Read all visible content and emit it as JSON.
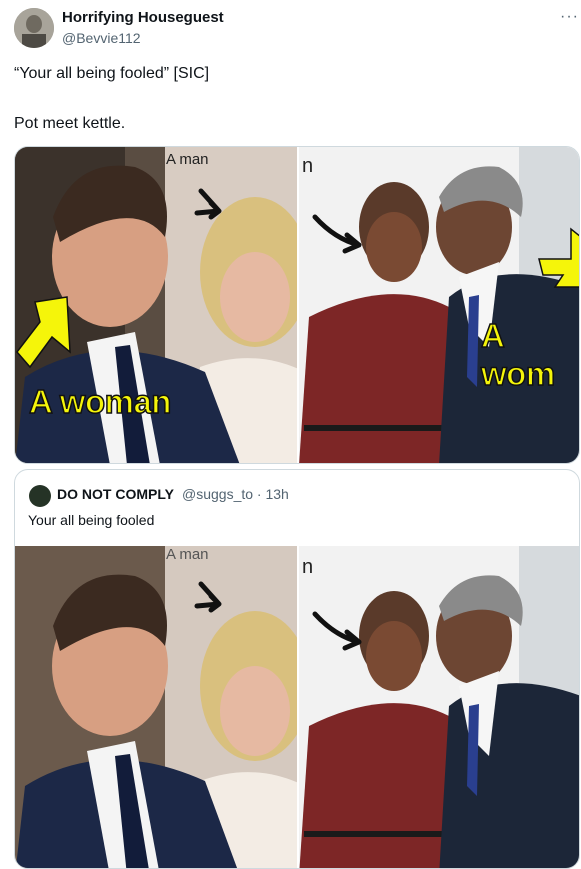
{
  "author": {
    "display_name": "Horrifying Houseguest",
    "handle": "@Bevvie112",
    "avatar_icon": "profile-photo"
  },
  "more_icon": "more-dots-icon",
  "tweet": {
    "line1": "“Your all being fooled” [SIC]",
    "line2": "Pot meet kettle."
  },
  "media": {
    "left_top_label": "A man",
    "left_bottom_label": "A woman",
    "right_top_label": "n",
    "right_side_label": "A wom"
  },
  "quoted": {
    "display_name": "DO NOT COMPLY",
    "handle": "@suggs_to · 13h",
    "text": "Your all being fooled",
    "media": {
      "left_top_label": "A man",
      "right_top_label": "n"
    }
  },
  "colors": {
    "arrow_yellow": "#f5f50a",
    "border": "#cfd9de",
    "secondary_text": "#536471"
  }
}
